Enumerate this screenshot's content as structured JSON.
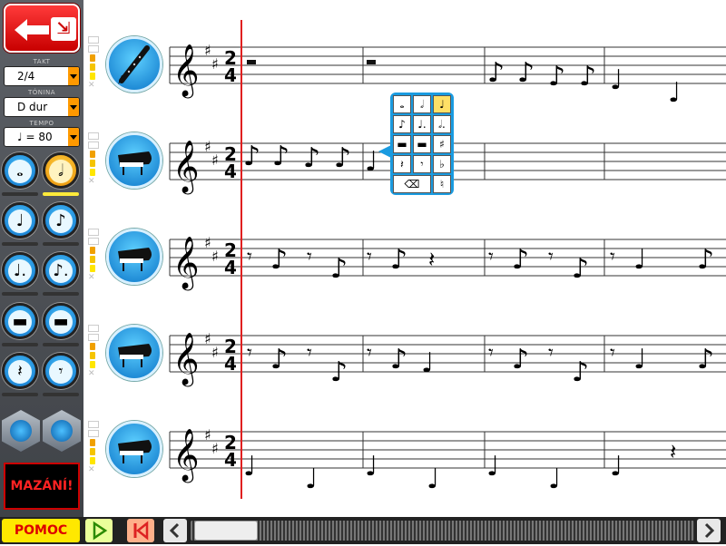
{
  "sidebar": {
    "takt": {
      "label": "TAKT",
      "value": "2/4"
    },
    "tonina": {
      "label": "TÓNINA",
      "value": "D dur"
    },
    "tempo": {
      "label": "TEMPO",
      "value": "♩ = 80"
    },
    "note_buttons": [
      {
        "name": "whole-note",
        "glyph": "𝅝"
      },
      {
        "name": "half-note",
        "glyph": "𝅗𝅥"
      },
      {
        "name": "quarter-note",
        "glyph": "♩"
      },
      {
        "name": "eighth-note",
        "glyph": "♪"
      },
      {
        "name": "dotted-quarter-note",
        "glyph": "♩."
      },
      {
        "name": "dotted-eighth-note",
        "glyph": "♪."
      },
      {
        "name": "whole-rest",
        "glyph": "▬"
      },
      {
        "name": "half-rest",
        "glyph": "▬"
      },
      {
        "name": "quarter-rest",
        "glyph": "𝄽"
      },
      {
        "name": "eighth-rest",
        "glyph": "𝄾"
      }
    ],
    "delete_label": "MAZÁNÍ!"
  },
  "bottombar": {
    "help_label": "POMOC"
  },
  "popup": {
    "cells": [
      "𝅝",
      "𝅗𝅥",
      "♩",
      "♪",
      "♩.",
      "𝅗𝅥.",
      "▬",
      "▬",
      "♯",
      "𝄽",
      "𝄾",
      "♭",
      "⌫",
      "♮"
    ]
  },
  "score": {
    "time_signature": {
      "top": "2",
      "bottom": "4"
    },
    "staves": [
      {
        "instrument": "clarinet-icon"
      },
      {
        "instrument": "grand-piano-icon"
      },
      {
        "instrument": "grand-piano-icon"
      },
      {
        "instrument": "grand-piano-icon"
      },
      {
        "instrument": "grand-piano-icon"
      }
    ]
  }
}
